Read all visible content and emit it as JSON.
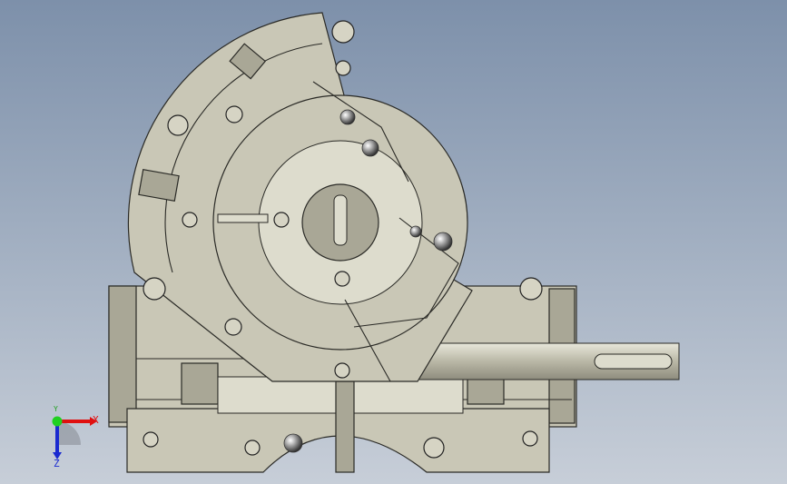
{
  "viewport": {
    "model": "gearbox-section-view",
    "colors": {
      "background_top": "#7d90aa",
      "background_bottom": "#c7ced8",
      "model": "#c9c7b6",
      "edge": "#2a2a26"
    }
  },
  "triad": {
    "x_label": "X",
    "y_label": "Y",
    "z_label": "Z",
    "colors": {
      "x": "#e01010",
      "y": "#20d020",
      "z": "#1a2ad0"
    }
  }
}
